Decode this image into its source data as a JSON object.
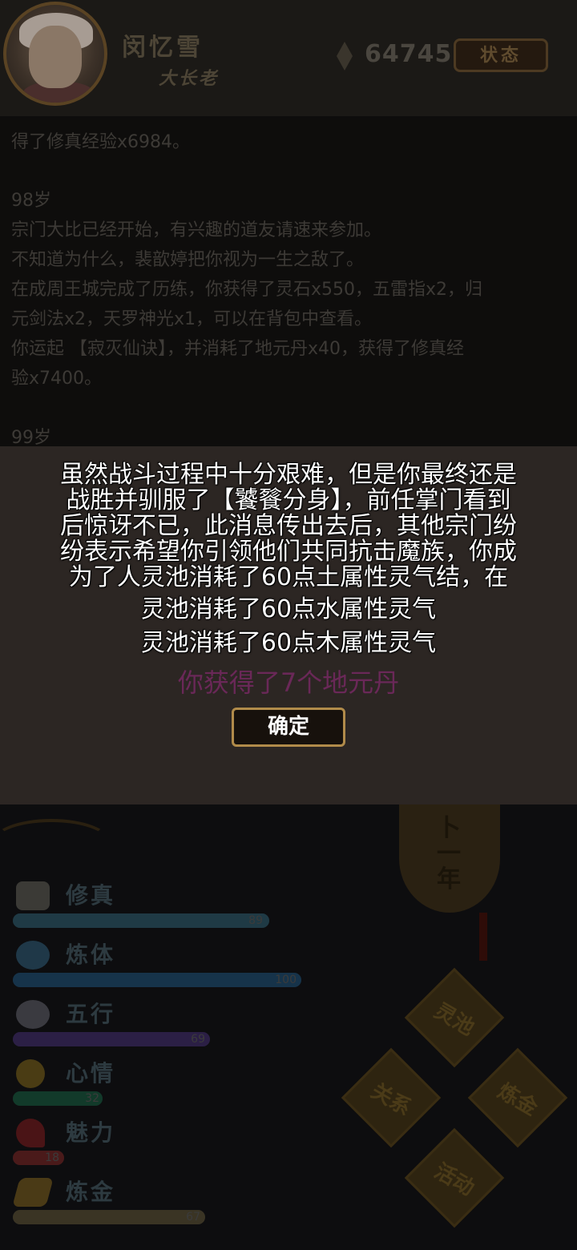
{
  "header": {
    "player_name": "闵忆雪",
    "player_title": "大长老",
    "gem_count": "64745",
    "status_button": "状态",
    "avatar_icon": "elder-portrait-icon",
    "gem_icon": "diamond-gem-icon"
  },
  "log": {
    "lines": [
      "得了修真经验x6984。",
      "",
      "98岁",
      "宗门大比已经开始，有兴趣的道友请速来参加。",
      "不知道为什么，裴歆婷把你视为一生之敌了。",
      "在成周王城完成了历练，你获得了灵石x550，五雷指x2，归",
      "元剑法x2，天罗神光x1，可以在背包中查看。",
      "你运起 【寂灭仙诀】，并消耗了地元丹x40，获得了修真经",
      "验x7400。",
      "",
      "99岁"
    ]
  },
  "modal": {
    "lines": [
      "虽然战斗过程中十分艰难，但是你最终还是",
      "战胜并驯服了【饕餮分身】，前任掌门看到",
      "后惊讶不已，此消息传出去后，其他宗门纷",
      "纷表示希望你引领他们共同抗击魔族，你成",
      "为了人灵池消耗了60点土属性灵气结，在",
      "灵池消耗了60点水属性灵气",
      "灵池消耗了60点木属性灵气"
    ],
    "reward": "你获得了7个地元丹",
    "confirm_button": "确定",
    "reward_color": "#6a2858"
  },
  "lantern": {
    "chars": [
      "卜",
      "一",
      "年"
    ]
  },
  "stats": [
    {
      "label": "修真",
      "value": "89",
      "fraction": 1.0,
      "color": "#1f3a45",
      "icon": "book-icon"
    },
    {
      "label": "炼体",
      "value": "100",
      "fraction": 1.0,
      "color": "#16334a",
      "icon": "gourd-icon"
    },
    {
      "label": "五行",
      "value": "69",
      "fraction": 1.0,
      "color": "#2b1f45",
      "icon": "pouch-icon"
    },
    {
      "label": "心情",
      "value": "32",
      "fraction": 1.0,
      "color": "#123a2a",
      "icon": "smile-icon"
    },
    {
      "label": "魅力",
      "value": "18",
      "fraction": 1.0,
      "color": "#4a1a1a",
      "icon": "heart-icon"
    },
    {
      "label": "炼金",
      "value": "67",
      "fraction": 1.0,
      "color": "#3a3424",
      "icon": "ingot-icon"
    }
  ],
  "actions": {
    "pool": "灵池",
    "relations": "关系",
    "alchemy": "炼金",
    "activity": "活动"
  }
}
